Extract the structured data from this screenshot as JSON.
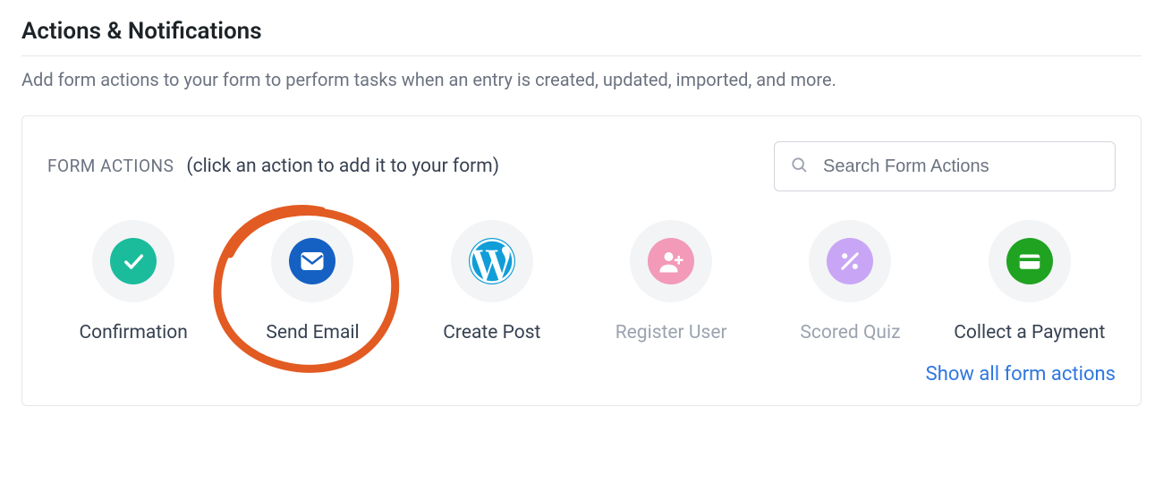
{
  "section": {
    "title": "Actions & Notifications",
    "description": "Add form actions to your form to perform tasks when an entry is created, updated, imported, and more."
  },
  "panel": {
    "label": "FORM ACTIONS",
    "hint": "(click an action to add it to your form)",
    "search_placeholder": "Search Form Actions",
    "show_all": "Show all form actions"
  },
  "actions": [
    {
      "label": "Confirmation",
      "icon": "check",
      "color": "teal",
      "muted": false
    },
    {
      "label": "Send Email",
      "icon": "mail",
      "color": "blue",
      "muted": false,
      "annotated": true
    },
    {
      "label": "Create Post",
      "icon": "wordpress",
      "color": "wp",
      "muted": false
    },
    {
      "label": "Register User",
      "icon": "user-add",
      "color": "pink",
      "muted": true
    },
    {
      "label": "Scored Quiz",
      "icon": "percent",
      "color": "purple",
      "muted": true
    },
    {
      "label": "Collect a Payment",
      "icon": "card",
      "color": "green",
      "muted": false
    }
  ],
  "annotation": {
    "color": "#e25b22"
  }
}
